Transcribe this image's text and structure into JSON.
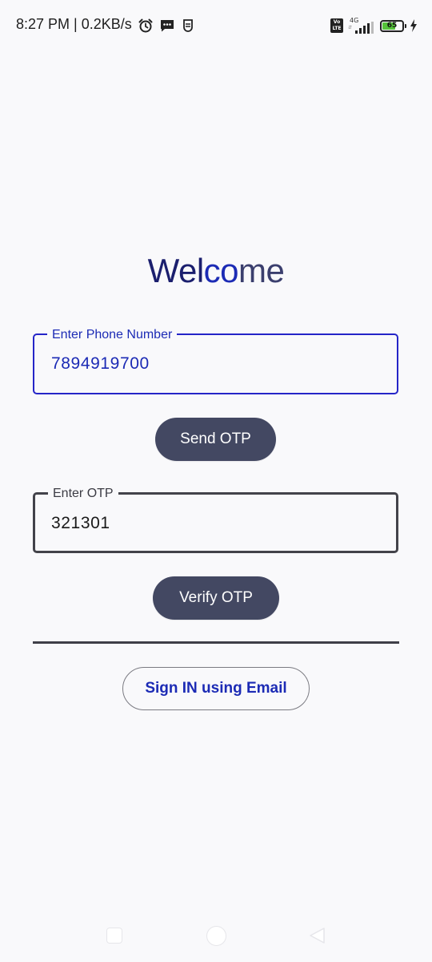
{
  "status_bar": {
    "time_text": "8:27 PM | 0.2KB/s",
    "icons": [
      "alarm-icon",
      "message-icon",
      "shield-icon"
    ],
    "volte_line1": "Vo",
    "volte_line2": "LTE",
    "network_type": "4G",
    "network_arrows": "⇵",
    "battery_level": "65",
    "battery_fraction": 0.65,
    "battery_color": "#55c23a",
    "charging_icon": "bolt-icon"
  },
  "main": {
    "title_part1": "Wel",
    "title_part2": "co",
    "title_part3": "me",
    "phone_field": {
      "label": "Enter Phone Number",
      "value": "7894919700",
      "accent": "#1c2bb5"
    },
    "send_otp_label": "Send OTP",
    "otp_field": {
      "label": "Enter OTP",
      "value": "321301"
    },
    "verify_otp_label": "Verify OTP",
    "email_signin_label": "Sign IN using Email",
    "button_color": "#434862"
  },
  "nav_bar": {
    "buttons": [
      "recents-icon",
      "home-icon",
      "back-icon"
    ]
  }
}
